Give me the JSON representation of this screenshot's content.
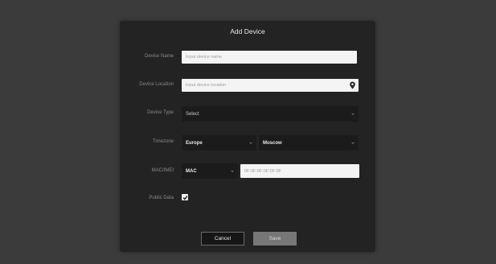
{
  "dialog": {
    "title": "Add Device"
  },
  "fields": {
    "device_name": {
      "label": "Device Name",
      "placeholder": "Input device name"
    },
    "device_location": {
      "label": "Device Location",
      "placeholder": "Input device location",
      "icon": "map-pin-icon"
    },
    "device_type": {
      "label": "Device Type",
      "value": "Select"
    },
    "timezone": {
      "label": "Timezone",
      "region": "Europe",
      "city": "Moscow"
    },
    "mac_imei": {
      "label": "MAC/IMEI",
      "type": "MAC",
      "placeholder": "0F:0F:0F:0F:0F:0F"
    },
    "public_data": {
      "label": "Public Data",
      "checked": true
    }
  },
  "buttons": {
    "cancel": "Cancel",
    "save": "Save"
  },
  "colors": {
    "backdrop": "#3b3b3b",
    "modal": "#232323",
    "dark_select": "#1b1b1b",
    "save_button": "#777777"
  }
}
